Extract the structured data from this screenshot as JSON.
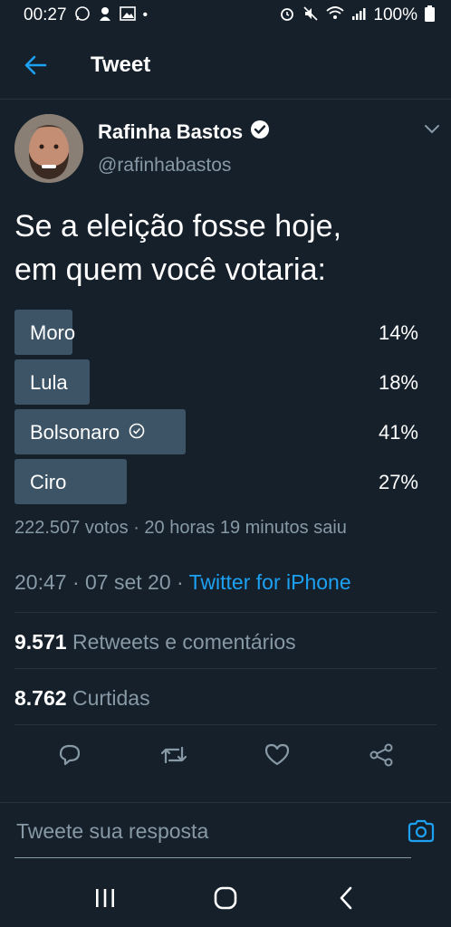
{
  "status_bar": {
    "time": "00:27",
    "battery": "100%",
    "left_icons": [
      "whatsapp-icon",
      "notification-icon",
      "image-icon"
    ],
    "right_icons": [
      "alarm-icon",
      "mute-icon",
      "wifi-icon",
      "signal-icon",
      "battery-icon"
    ]
  },
  "header": {
    "title": "Tweet"
  },
  "author": {
    "name": "Rafinha Bastos",
    "handle": "@rafinhabastos",
    "verified": true
  },
  "tweet": {
    "text_line1": "Se a eleição fosse hoje,",
    "text_line2": "em quem você votaria:"
  },
  "poll": {
    "options": [
      {
        "label": "Moro",
        "percent": "14%",
        "fraction": 0.14,
        "selected": false
      },
      {
        "label": "Lula",
        "percent": "18%",
        "fraction": 0.18,
        "selected": false
      },
      {
        "label": "Bolsonaro",
        "percent": "41%",
        "fraction": 0.41,
        "selected": true
      },
      {
        "label": "Ciro",
        "percent": "27%",
        "fraction": 0.27,
        "selected": false
      }
    ],
    "meta": "222.507 votos · 20 horas 19 minutos saiu"
  },
  "timestamp": {
    "time_date": "20:47 · 07 set 20 · ",
    "source": "Twitter for iPhone"
  },
  "stats": {
    "retweets_count": "9.571",
    "retweets_label": "Retweets e comentários",
    "likes_count": "8.762",
    "likes_label": "Curtidas"
  },
  "reply": {
    "placeholder": "Tweete sua resposta"
  },
  "colors": {
    "background": "#15202b",
    "accent": "#1da1f2",
    "secondary_text": "#8899a6",
    "poll_bar": "#3d5466",
    "divider": "#253341"
  }
}
